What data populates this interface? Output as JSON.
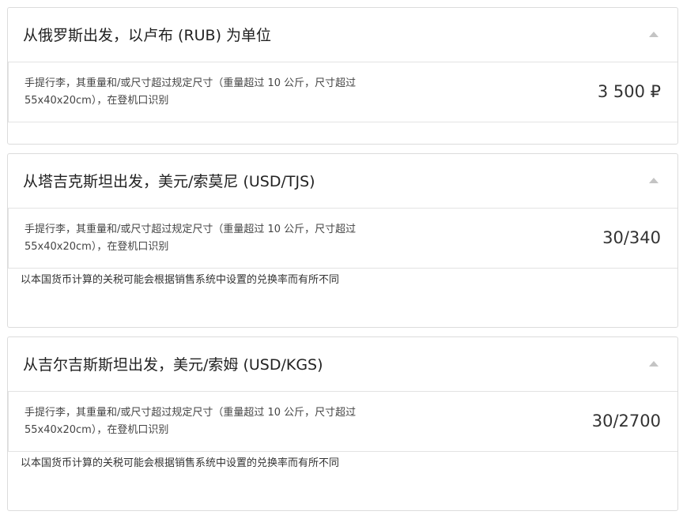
{
  "sections": [
    {
      "title": "从俄罗斯出发，以卢布 (RUB) 为单位",
      "fee": {
        "description": "手提行李，其重量和/或尺寸超过规定尺寸（重量超过 10 公斤，尺寸超过 55x40x20cm），在登机口识别",
        "price": "3 500 ₽"
      },
      "note": ""
    },
    {
      "title": "从塔吉克斯坦出发，美元/索莫尼 (USD/TJS)",
      "fee": {
        "description": "手提行李，其重量和/或尺寸超过规定尺寸（重量超过 10 公斤，尺寸超过 55x40x20cm），在登机口识别",
        "price": "30/340"
      },
      "note": "以本国货币计算的关税可能会根据销售系统中设置的兑换率而有所不同"
    },
    {
      "title": "从吉尔吉斯斯坦出发，美元/索姆 (USD/KGS)",
      "fee": {
        "description": "手提行李，其重量和/或尺寸超过规定尺寸（重量超过 10 公斤，尺寸超过 55x40x20cm），在登机口识别",
        "price": "30/2700"
      },
      "note": "以本国货币计算的关税可能会根据销售系统中设置的兑换率而有所不同"
    }
  ]
}
